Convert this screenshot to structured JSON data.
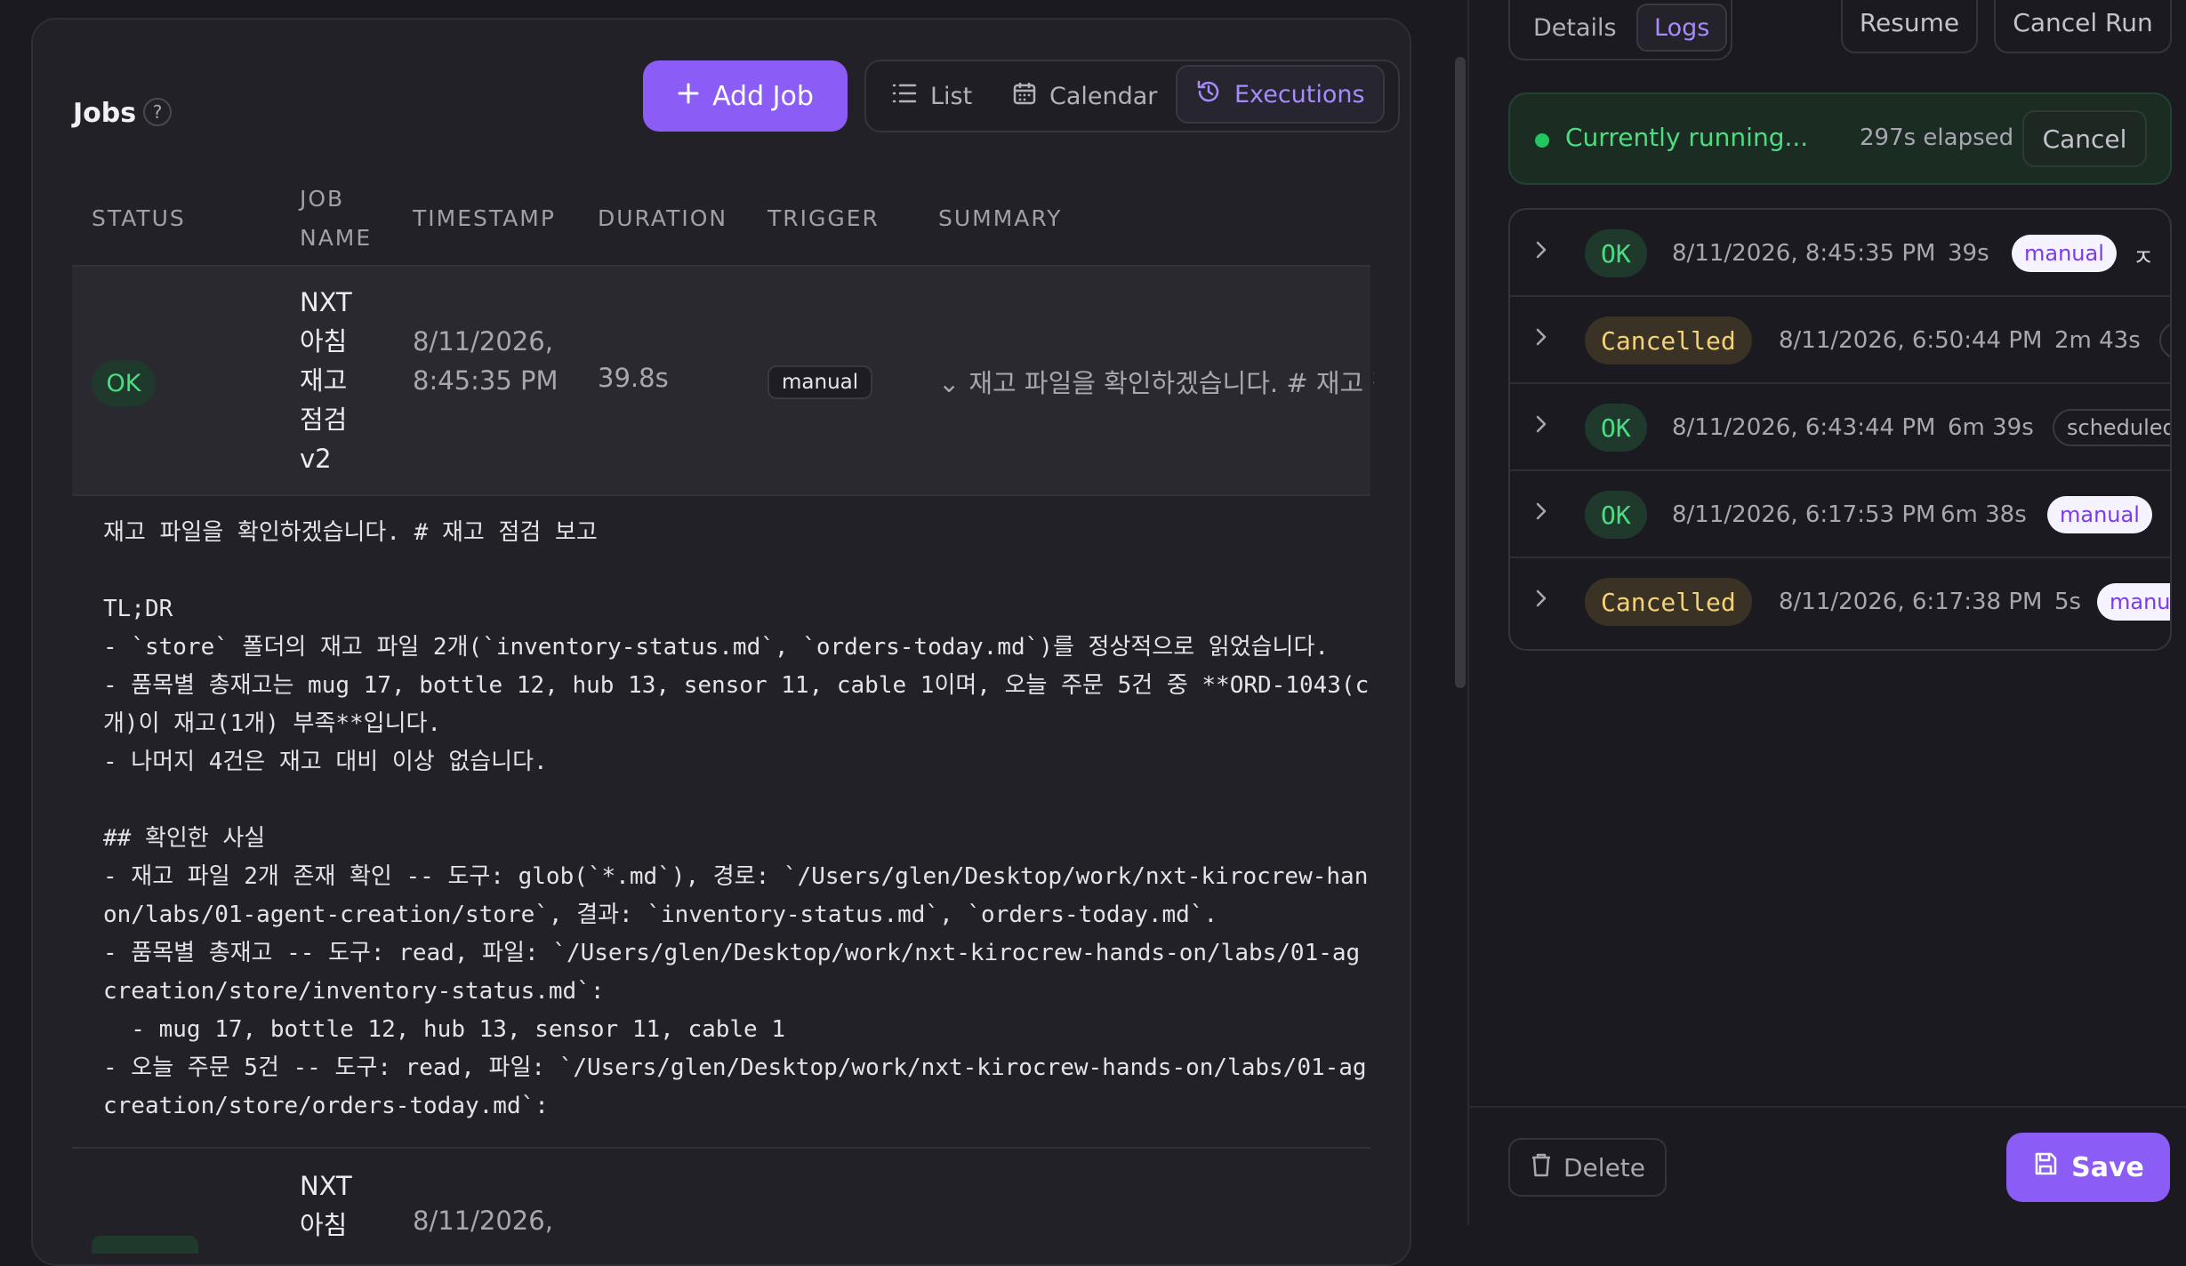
{
  "jobs_panel": {
    "title": "Jobs",
    "help_label": "?",
    "add_job_label": "Add Job",
    "views": {
      "list": "List",
      "calendar": "Calendar",
      "executions": "Executions"
    },
    "columns": {
      "status": "STATUS",
      "job_name": "JOB NAME",
      "timestamp": "TIMESTAMP",
      "duration": "DURATION",
      "trigger": "TRIGGER",
      "summary": "SUMMARY"
    },
    "rows": [
      {
        "status": "OK",
        "job_name": "NXT 아침 재고 점검 v2",
        "timestamp": "8/11/2026, 8:45:35 PM",
        "duration": "39.8s",
        "trigger": "manual",
        "summary": "재고 파일을 확인하겠습니다. # 재고 점검 보고"
      },
      {
        "job_name": "NXT 아침",
        "timestamp": "8/11/2026,"
      }
    ],
    "output": "재고 파일을 확인하겠습니다. # 재고 점검 보고\n\nTL;DR\n- `store` 폴더의 재고 파일 2개(`inventory-status.md`, `orders-today.md`)를 정상적으로 읽었습니다.\n- 품목별 총재고는 mug 17, bottle 12, hub 13, sensor 11, cable 1이며, 오늘 주문 5건 중 **ORD-1043(c\n개)이 재고(1개) 부족**입니다.\n- 나머지 4건은 재고 대비 이상 없습니다.\n\n## 확인한 사실\n- 재고 파일 2개 존재 확인 -- 도구: glob(`*.md`), 경로: `/Users/glen/Desktop/work/nxt-kirocrew-han\non/labs/01-agent-creation/store`, 결과: `inventory-status.md`, `orders-today.md`.\n- 품목별 총재고 -- 도구: read, 파일: `/Users/glen/Desktop/work/nxt-kirocrew-hands-on/labs/01-ag\ncreation/store/inventory-status.md`:\n  - mug 17, bottle 12, hub 13, sensor 11, cable 1\n- 오늘 주문 5건 -- 도구: read, 파일: `/Users/glen/Desktop/work/nxt-kirocrew-hands-on/labs/01-ag\ncreation/store/orders-today.md`:"
  },
  "detail_panel": {
    "tabs": {
      "details": "Details",
      "logs": "Logs"
    },
    "resume_label": "Resume",
    "cancel_run_label": "Cancel Run",
    "running": {
      "text": "Currently running...",
      "elapsed": "297s elapsed",
      "cancel_label": "Cancel"
    },
    "history": [
      {
        "status": "OK",
        "timestamp": "8/11/2026, 8:45:35 PM",
        "duration": "39s",
        "trigger": "manual",
        "extra": "ㅈ"
      },
      {
        "status": "Cancelled",
        "timestamp": "8/11/2026, 6:50:44 PM",
        "duration": "2m 43s",
        "trigger": ""
      },
      {
        "status": "OK",
        "timestamp": "8/11/2026, 6:43:44 PM",
        "duration": "6m 39s",
        "trigger": "scheduled"
      },
      {
        "status": "OK",
        "timestamp": "8/11/2026, 6:17:53 PM",
        "duration": "6m 38s",
        "trigger": "manual"
      },
      {
        "status": "Cancelled",
        "timestamp": "8/11/2026, 6:17:38 PM",
        "duration": "5s",
        "trigger": "manual"
      }
    ],
    "delete_label": "Delete",
    "save_label": "Save"
  },
  "colors": {
    "accent": "#8b5cf6",
    "ok": "#4ade80",
    "cancelled": "#f3d27a"
  },
  "icons": [
    "help-icon",
    "plus-icon",
    "list-icon",
    "calendar-icon",
    "history-icon",
    "chevron-down-icon",
    "chevron-right-icon",
    "trash-icon",
    "save-icon"
  ]
}
